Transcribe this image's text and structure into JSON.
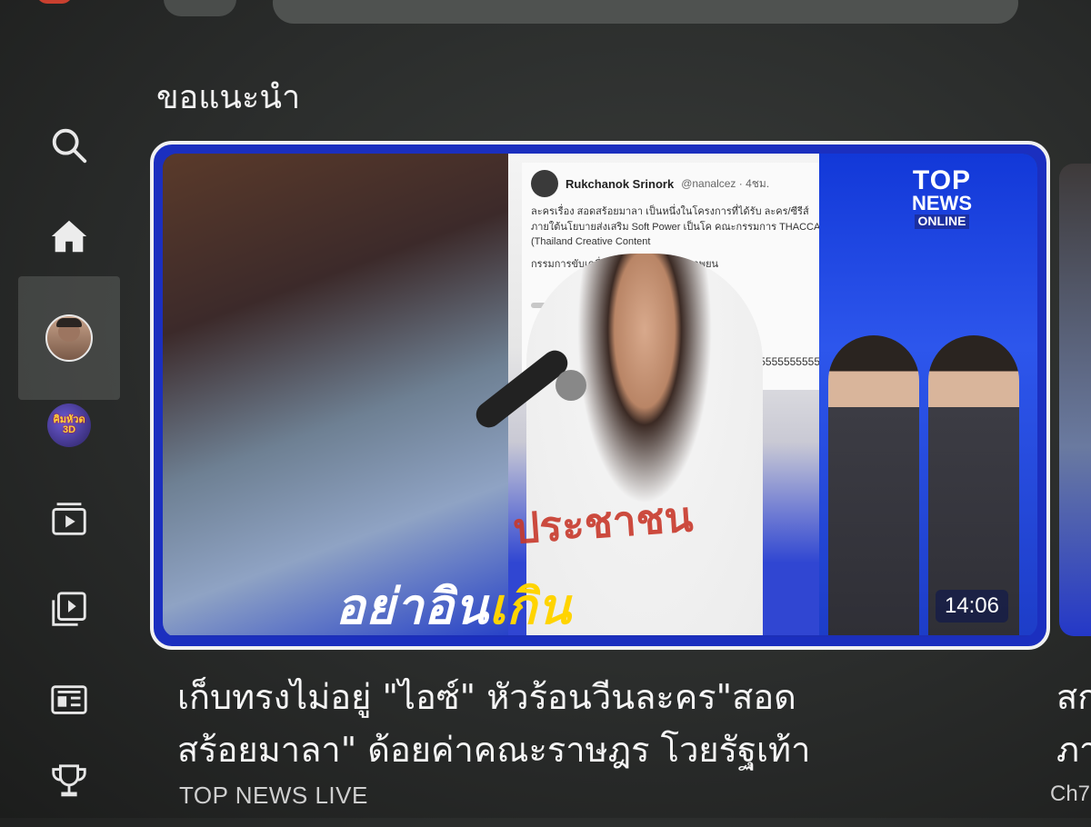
{
  "section": {
    "title": "ขอแนะนำ"
  },
  "sidebar": {
    "items": [
      {
        "name": "search",
        "icon": "search-icon"
      },
      {
        "name": "home",
        "icon": "home-icon"
      },
      {
        "name": "profile",
        "icon": "avatar"
      },
      {
        "name": "channel",
        "icon": "channel-avatar",
        "label": "คิมหัวด 3D"
      },
      {
        "name": "subscriptions",
        "icon": "subscriptions-icon"
      },
      {
        "name": "library",
        "icon": "library-icon"
      },
      {
        "name": "news",
        "icon": "news-icon"
      },
      {
        "name": "trophy",
        "icon": "trophy-icon"
      }
    ]
  },
  "video": {
    "title_line1": "เก็บทรงไม่อยู่ \"ไอซ์\" หัวร้อนวีนละคร\"สอด",
    "title_line2": "สร้อยมาลา\" ด้อยค่าคณะราษฎร โวยรัฐเท้า",
    "channel": "TOP NEWS LIVE",
    "duration": "14:06",
    "thumbnail": {
      "headline_white": "อย่าอิน",
      "headline_yellow": "เกิน",
      "shirt_text": "ประชาชน",
      "logo_line1": "TOP",
      "logo_line2": "NEWS",
      "logo_line3": "ONLINE",
      "tweet": {
        "name": "Rukchanok Srinork",
        "handle": "@nanalcez · 4ชม.",
        "body": "ละครเรื่อง สอดสร้อยมาลา เป็นหนึ่งในโครงการที่ได้รับ ละคร/ซีรีส์ ภายใต้นโยบายส่งเสริม Soft Power เป็นโค คณะกรรมการ THACCA (Thailand Creative Content",
        "body2": "กรรมการขับเคลื่อนอุตสาหกรรมด้านภาพยน",
        "number_line": "สิ้มสุดๆ เป็นสเตรทแล้วยังเป็นสิ้มอีก ค้าเลย 5555555555555555"
      }
    }
  },
  "next_video": {
    "title_partial": "สก",
    "title_partial2": "ภา",
    "channel_partial": "Ch7"
  },
  "colors": {
    "background": "#2a2c2b",
    "card_border": "#f1f1f1",
    "thumbnail_blue": "#1c2fb8",
    "headline_yellow": "#ffd400"
  }
}
